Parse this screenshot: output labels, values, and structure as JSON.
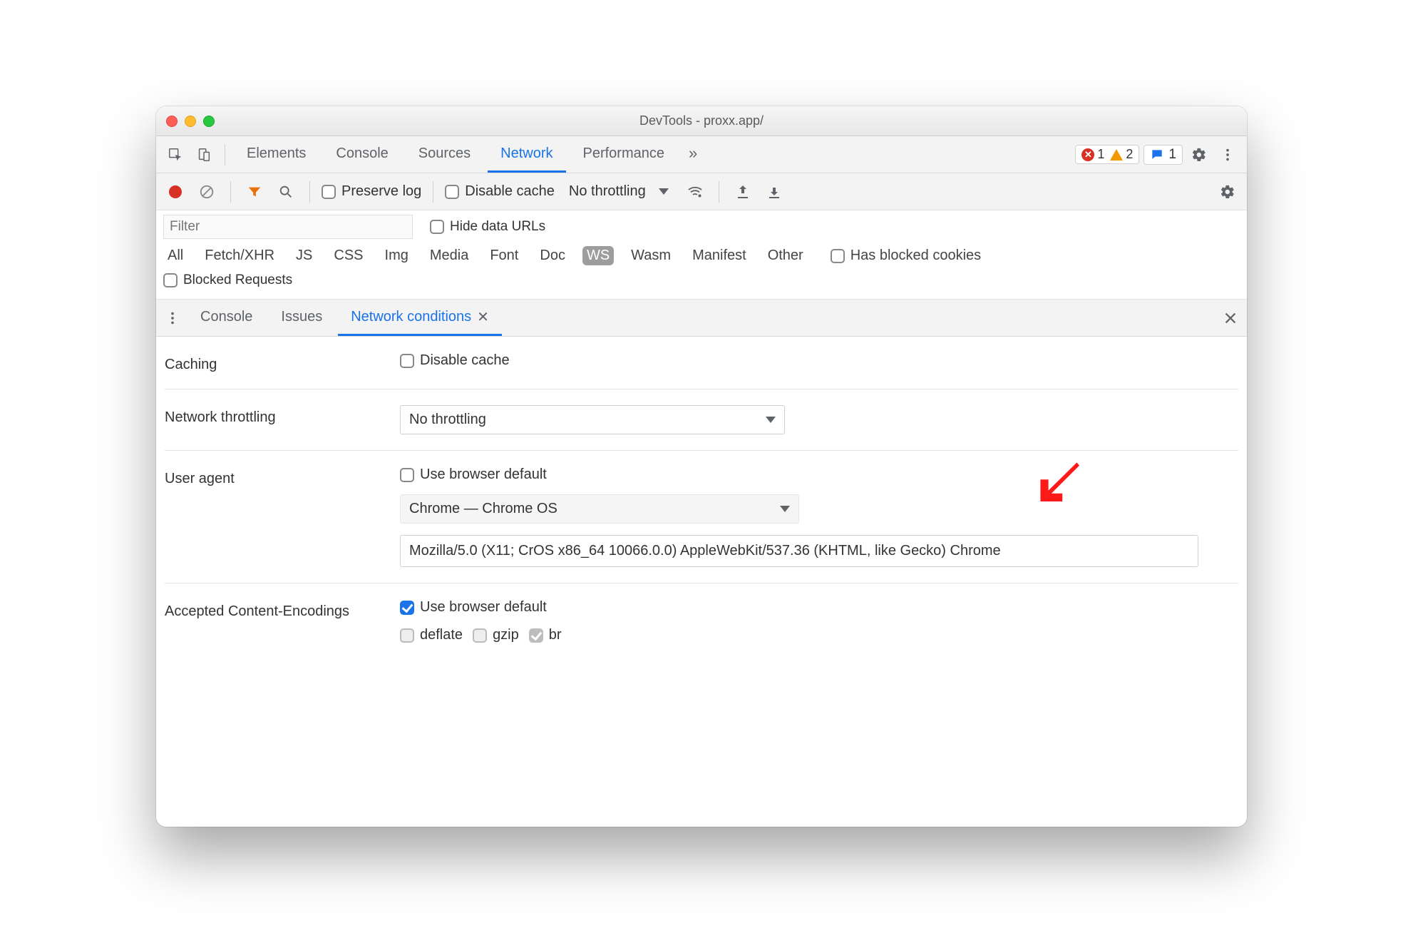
{
  "window": {
    "title": "DevTools - proxx.app/"
  },
  "mainTabs": {
    "items": [
      "Elements",
      "Console",
      "Sources",
      "Network",
      "Performance"
    ],
    "active": "Network",
    "overflow": "»",
    "errorsCount": "1",
    "warningsCount": "2",
    "messagesCount": "1"
  },
  "netToolbar": {
    "preserveLog": "Preserve log",
    "disableCache": "Disable cache",
    "throttling": "No throttling"
  },
  "filter": {
    "placeholder": "Filter",
    "hideDataUrls": "Hide data URLs",
    "chips": [
      "All",
      "Fetch/XHR",
      "JS",
      "CSS",
      "Img",
      "Media",
      "Font",
      "Doc",
      "WS",
      "Wasm",
      "Manifest",
      "Other"
    ],
    "activeChip": "WS",
    "hasBlockedCookies": "Has blocked cookies",
    "blockedRequests": "Blocked Requests"
  },
  "drawer": {
    "tabs": [
      "Console",
      "Issues",
      "Network conditions"
    ],
    "active": "Network conditions"
  },
  "conditions": {
    "cachingLabel": "Caching",
    "disableCache": "Disable cache",
    "throttlingLabel": "Network throttling",
    "throttlingValue": "No throttling",
    "uaLabel": "User agent",
    "uaUseBrowserDefault": "Use browser default",
    "uaPreset": "Chrome — Chrome OS",
    "uaString": "Mozilla/5.0 (X11; CrOS x86_64 10066.0.0) AppleWebKit/537.36 (KHTML, like Gecko) Chrome",
    "encLabel": "Accepted Content-Encodings",
    "encUseBrowserDefault": "Use browser default",
    "encDeflate": "deflate",
    "encGzip": "gzip",
    "encBr": "br"
  }
}
